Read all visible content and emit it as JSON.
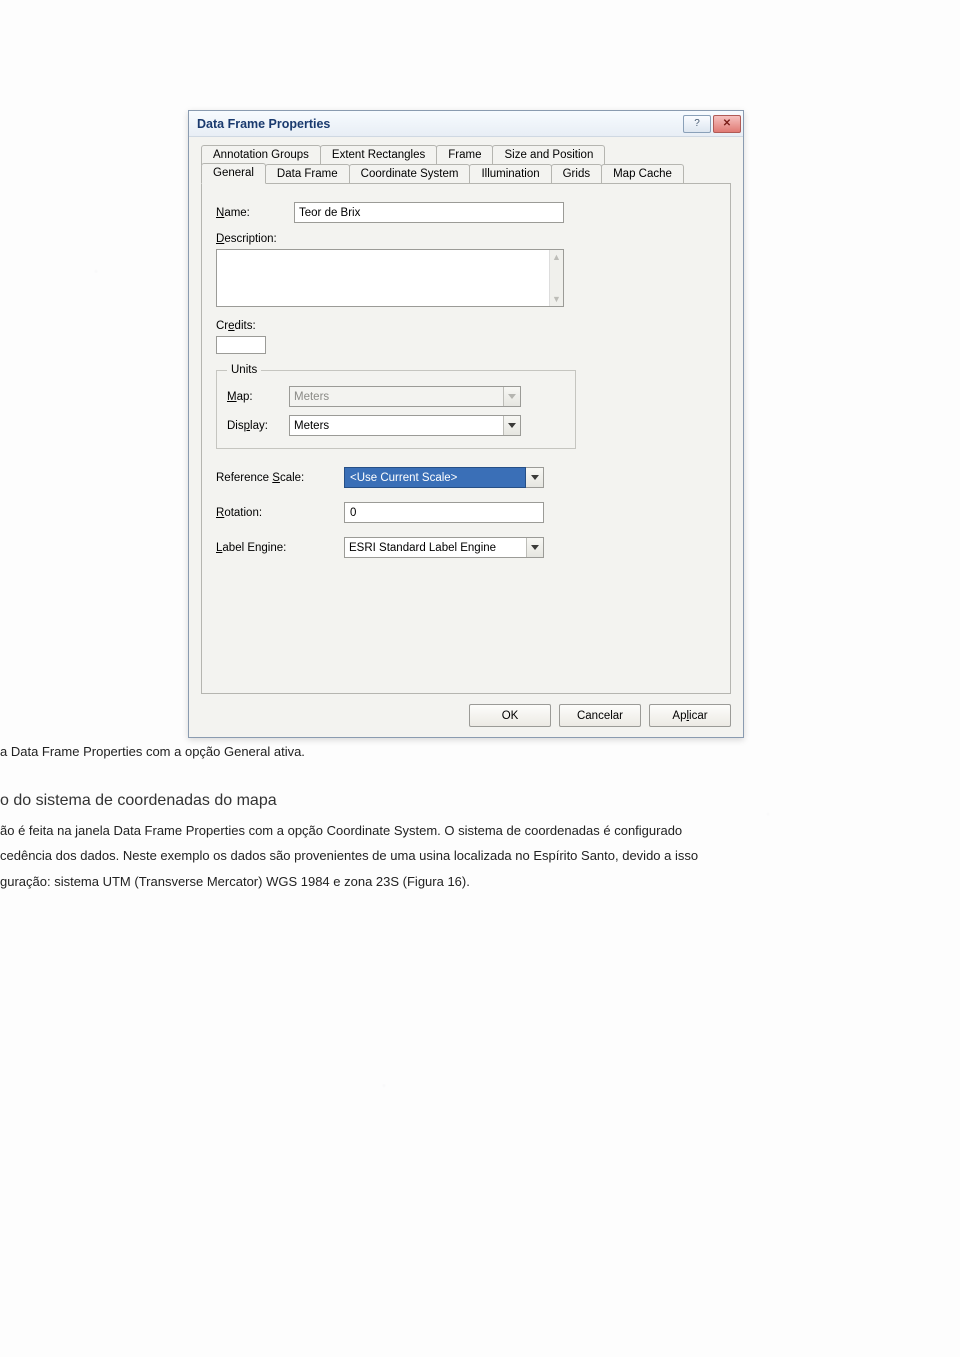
{
  "dialog": {
    "title": "Data Frame Properties",
    "help_icon": "?",
    "close_icon": "✕",
    "tabs_row1": [
      {
        "label": "Annotation Groups"
      },
      {
        "label": "Extent Rectangles"
      },
      {
        "label": "Frame"
      },
      {
        "label": "Size and Position"
      }
    ],
    "tabs_row2": [
      {
        "label": "General",
        "active": true
      },
      {
        "label": "Data Frame"
      },
      {
        "label": "Coordinate System"
      },
      {
        "label": "Illumination"
      },
      {
        "label": "Grids"
      },
      {
        "label": "Map Cache"
      }
    ],
    "fields": {
      "name_label_pre": "N",
      "name_label_post": "ame:",
      "name_value": "Teor de Brix",
      "description_label_pre": "D",
      "description_label_post": "escription:",
      "description_value": "",
      "credits_label_pre": "Cr",
      "credits_label_u": "e",
      "credits_label_post": "dits:",
      "credits_value": "",
      "units_legend": "Units",
      "map_label_pre": "M",
      "map_label_post": "ap:",
      "map_value": "Meters",
      "display_label_pre": "Dis",
      "display_label_u": "p",
      "display_label_post": "lay:",
      "display_value": "Meters",
      "refscale_label_pre": "Reference ",
      "refscale_label_u": "S",
      "refscale_label_post": "cale:",
      "refscale_value": "<Use Current Scale>",
      "rotation_label_pre": "R",
      "rotation_label_post": "otation:",
      "rotation_value": "0",
      "labelengine_label_pre": "L",
      "labelengine_label_post": "abel Engine:",
      "labelengine_value": "ESRI Standard Label Engine"
    },
    "buttons": {
      "ok": "OK",
      "cancel": "Cancelar",
      "apply_pre": "Ap",
      "apply_u": "l",
      "apply_post": "icar"
    }
  },
  "caption": "a Data Frame Properties com a opção General ativa.",
  "heading": "o do sistema de coordenadas do mapa",
  "body": "ão é feita na janela Data Frame Properties com a opção Coordinate System. O sistema de coordenadas é configurado\ncedência dos dados. Neste exemplo os dados são provenientes de uma usina localizada no Espírito Santo, devido a isso\nguração: sistema UTM (Transverse Mercator) WGS 1984 e zona 23S (Figura 16)."
}
